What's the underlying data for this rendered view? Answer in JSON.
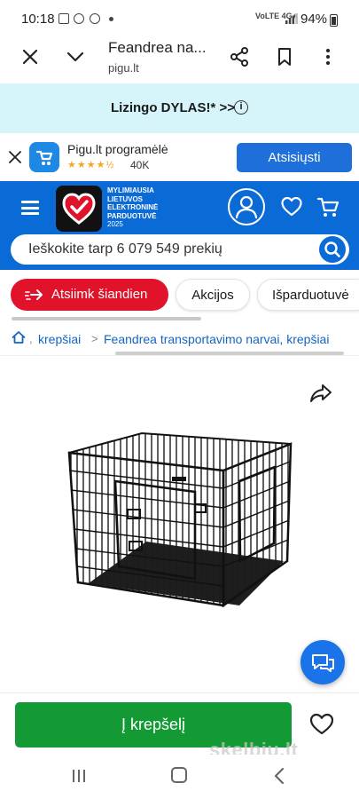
{
  "status_bar": {
    "time": "10:18",
    "network": "VoLTE 4G+",
    "battery": "94%"
  },
  "browser": {
    "title": "Feandrea na...",
    "domain": "pigu.lt"
  },
  "promo": {
    "text": "Lizingo DYLAS!* >>",
    "info_glyph": "i"
  },
  "app_banner": {
    "name": "Pigu.lt programėlė",
    "stars": "★★★★½",
    "rating_count": "40K",
    "download_label": "Atsisiųsti"
  },
  "header": {
    "logo_tagline": [
      "MYLIMIAUSIA",
      "LIETUVOS",
      "ELEKTRONINĖ",
      "PARDUOTUVĖ"
    ],
    "logo_year": "2025",
    "search_placeholder": "Ieškokite tarp 6 079 549 prekių"
  },
  "pills": {
    "pickup": "Atsiimk šiandien",
    "deals": "Akcijos",
    "sale": "Išparduotuvė"
  },
  "breadcrumb": {
    "category": "krepšiai",
    "item": "Feandrea transportavimo narvai, krepšiai"
  },
  "action": {
    "add_to_cart": "Į krepšelį"
  },
  "watermark": "skelbiu.lt",
  "colors": {
    "brand_blue": "#0a6ad6",
    "promo_bg": "#d6f5fb",
    "pickup_red": "#e0132b",
    "cart_green": "#149a34",
    "link_blue": "#1565c0",
    "chat_blue": "#1a73e8"
  },
  "icons": {
    "browser_close": "close-icon",
    "browser_chevron": "chevron-down-icon",
    "share": "share-icon",
    "bookmark": "bookmark-icon",
    "menu": "more-vert-icon",
    "info": "info-icon",
    "app": "pigu-app-icon",
    "hamburger": "menu-icon",
    "account": "user-icon",
    "wishlist": "heart-icon",
    "cart": "cart-icon",
    "search": "search-icon",
    "pickup": "arrow-right-icon",
    "home": "home-icon",
    "product_share": "share-arrow-icon",
    "chat": "chat-icon"
  }
}
